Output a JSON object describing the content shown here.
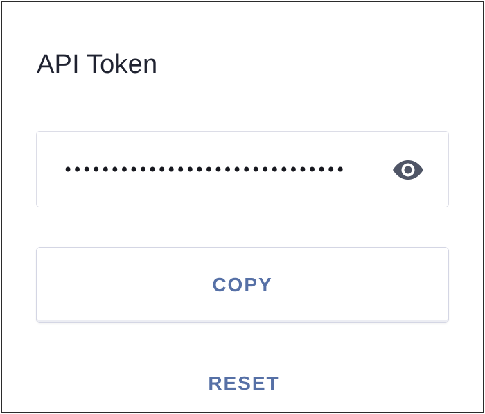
{
  "panel": {
    "title": "API Token"
  },
  "token_field": {
    "masked_value": "••••••••••••••••••••••••••••••",
    "visibility_icon": "eye-icon"
  },
  "actions": {
    "copy_label": "COPY",
    "reset_label": "RESET"
  },
  "colors": {
    "accent": "#5670a6",
    "title_text": "#1f2230",
    "border": "#dcdde7",
    "eye_icon": "#4f5566"
  }
}
